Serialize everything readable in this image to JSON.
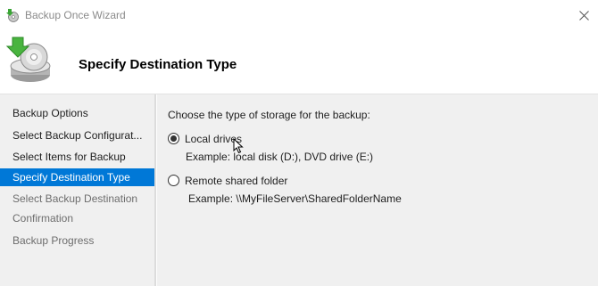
{
  "window": {
    "title": "Backup Once Wizard",
    "icons": {
      "app": "backup-wizard-icon",
      "close": "close-icon"
    }
  },
  "header": {
    "title": "Specify Destination Type",
    "icon": "backup-disk-icon"
  },
  "sidebar": {
    "steps": [
      {
        "label": "Backup Options",
        "state": "done"
      },
      {
        "label": "Select Backup Configurat...",
        "state": "done"
      },
      {
        "label": "Select Items for Backup",
        "state": "done"
      },
      {
        "label": "Specify Destination Type",
        "state": "current"
      },
      {
        "label": "Select Backup Destination",
        "state": "pending"
      },
      {
        "label": "Confirmation",
        "state": "pending"
      },
      {
        "label": "Backup Progress",
        "state": "pending"
      }
    ],
    "current_color": "#0078d7"
  },
  "main": {
    "prompt": "Choose the type of storage for the backup:",
    "options": [
      {
        "label": "Local drives",
        "example": "Example: local disk (D:), DVD drive (E:)",
        "selected": true
      },
      {
        "label": "Remote shared folder",
        "example": "Example: \\\\MyFileServer\\SharedFolderName",
        "selected": false
      }
    ]
  }
}
